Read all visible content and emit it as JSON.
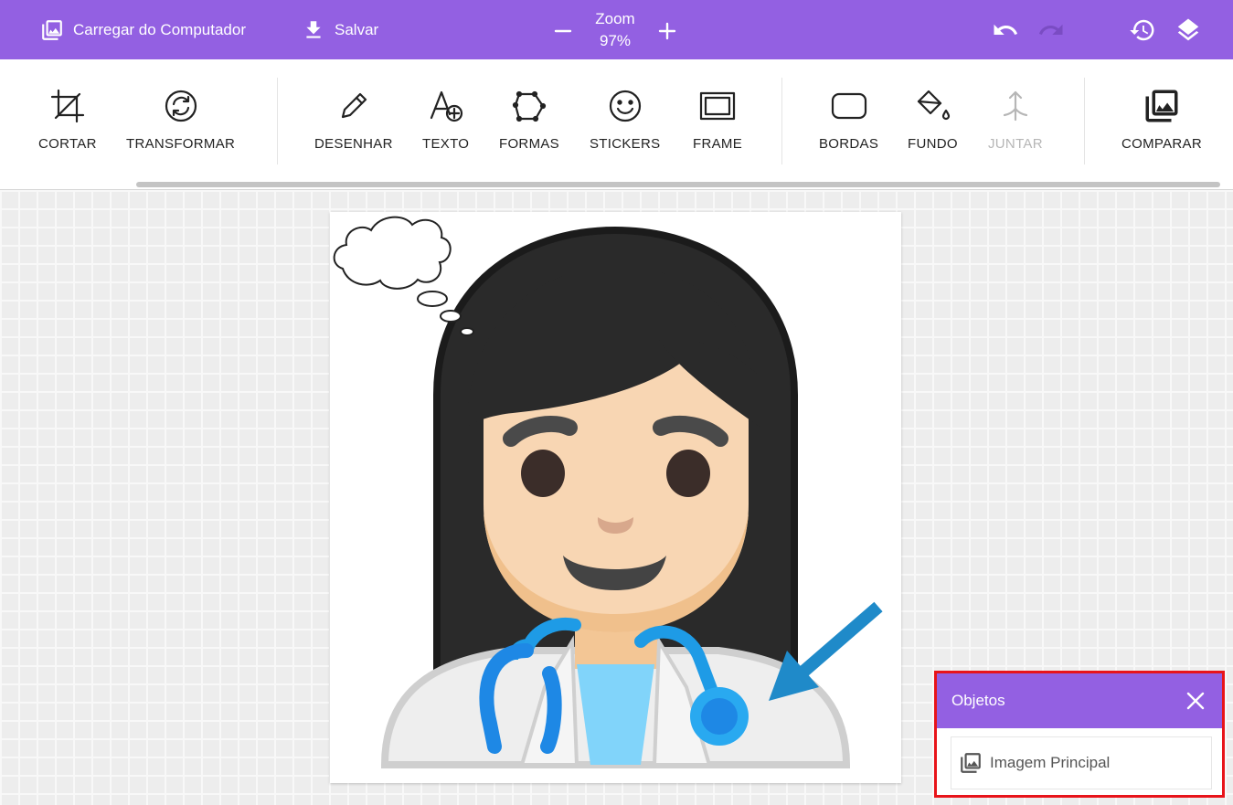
{
  "topbar": {
    "upload_label": "Carregar do Computador",
    "save_label": "Salvar",
    "zoom_title": "Zoom",
    "zoom_value": "97%",
    "bg_color": "#9360e2"
  },
  "toolbar": {
    "tools": [
      {
        "label": "CORTAR",
        "icon": "crop-icon"
      },
      {
        "label": "TRANSFORMAR",
        "icon": "rotate-icon"
      },
      {
        "label": "DESENHAR",
        "icon": "pencil-icon"
      },
      {
        "label": "TEXTO",
        "icon": "text-add-icon"
      },
      {
        "label": "FORMAS",
        "icon": "polygon-icon"
      },
      {
        "label": "STICKERS",
        "icon": "smiley-icon"
      },
      {
        "label": "FRAME",
        "icon": "frame-icon"
      },
      {
        "label": "BORDAS",
        "icon": "rounded-rect-icon"
      },
      {
        "label": "FUNDO",
        "icon": "paint-bucket-icon"
      },
      {
        "label": "JUNTAR",
        "icon": "merge-icon",
        "disabled": true
      },
      {
        "label": "COMPARAR",
        "icon": "compare-icon"
      }
    ]
  },
  "objects_panel": {
    "title": "Objetos",
    "items": [
      {
        "label": "Imagem Principal",
        "icon": "image-icon"
      }
    ],
    "highlight_color": "#e8141a"
  },
  "colors": {
    "accent": "#9360e2",
    "hair": "#2a2a2a",
    "skin": "#f8d6b3",
    "stethoscope": "#1e9be6",
    "arrow": "#1f8ac9"
  }
}
